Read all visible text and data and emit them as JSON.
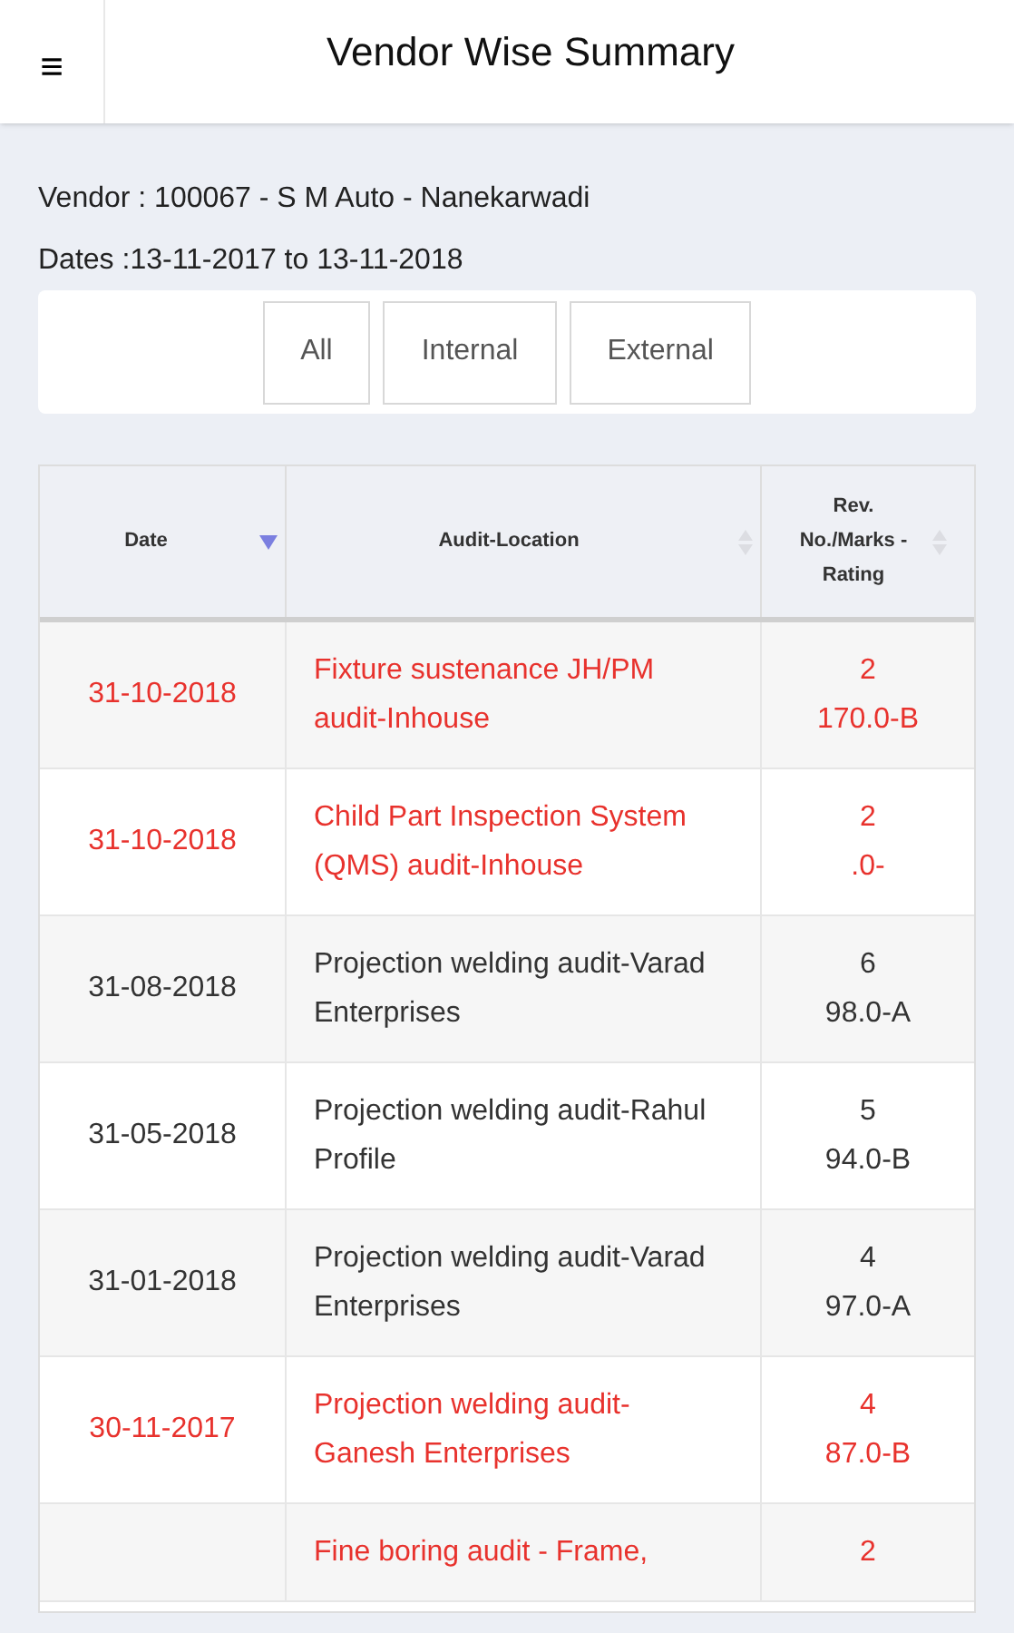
{
  "header": {
    "menu_icon": "≡",
    "title": "Vendor Wise Summary"
  },
  "vendor_line": "Vendor : 100067 - S M Auto - Nanekarwadi",
  "dates_line": "Dates :13-11-2017 to 13-11-2018",
  "filters": [
    {
      "label": "All",
      "selected": false
    },
    {
      "label": "Internal",
      "selected": false
    },
    {
      "label": "External",
      "selected": false
    }
  ],
  "table": {
    "columns": [
      {
        "label": "Date",
        "sorted": true
      },
      {
        "label": "Audit-Location",
        "sorted": false
      },
      {
        "label": "Rev. No./Marks -Rating",
        "sorted": false
      }
    ],
    "rows": [
      {
        "date": "31-10-2018",
        "location": "Fixture sustenance JH/PM audit-Inhouse",
        "rev": "2",
        "marks": "170.0-B",
        "highlight": true
      },
      {
        "date": "31-10-2018",
        "location": "Child Part Inspection System (QMS) audit-Inhouse",
        "rev": "2",
        "marks": ".0-",
        "highlight": true
      },
      {
        "date": "31-08-2018",
        "location": "Projection welding audit-Varad Enterprises",
        "rev": "6",
        "marks": "98.0-A",
        "highlight": false
      },
      {
        "date": "31-05-2018",
        "location": "Projection welding audit-Rahul Profile",
        "rev": "5",
        "marks": "94.0-B",
        "highlight": false
      },
      {
        "date": "31-01-2018",
        "location": "Projection welding audit-Varad Enterprises",
        "rev": "4",
        "marks": "97.0-A",
        "highlight": false
      },
      {
        "date": "30-11-2017",
        "location": "Projection welding audit-Ganesh Enterprises",
        "rev": "4",
        "marks": "87.0-B",
        "highlight": true
      },
      {
        "location": "Fine boring audit - Frame,",
        "rev": "2",
        "highlight": true
      }
    ]
  }
}
